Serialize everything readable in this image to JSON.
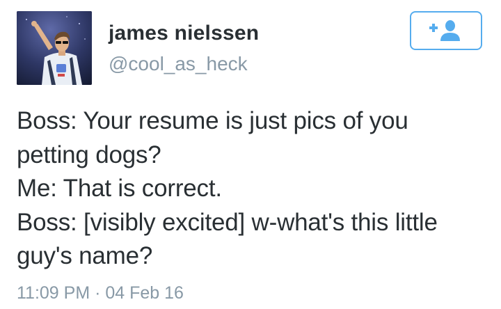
{
  "author": {
    "display_name": "james nielssen",
    "handle": "@cool_as_heck",
    "avatar_icon": "profile-photo"
  },
  "follow_button": {
    "icon": "follow-user-icon",
    "color": "#55acee"
  },
  "tweet": {
    "lines": [
      "Boss: Your resume is just pics of you",
      "petting dogs?",
      "Me: That is correct.",
      "Boss: [visibly excited] w-what's this little",
      "guy's name?"
    ],
    "timestamp": "11:09 PM · 04 Feb 16"
  },
  "colors": {
    "text": "#292f33",
    "secondary": "#8899a6",
    "accent": "#55acee"
  }
}
